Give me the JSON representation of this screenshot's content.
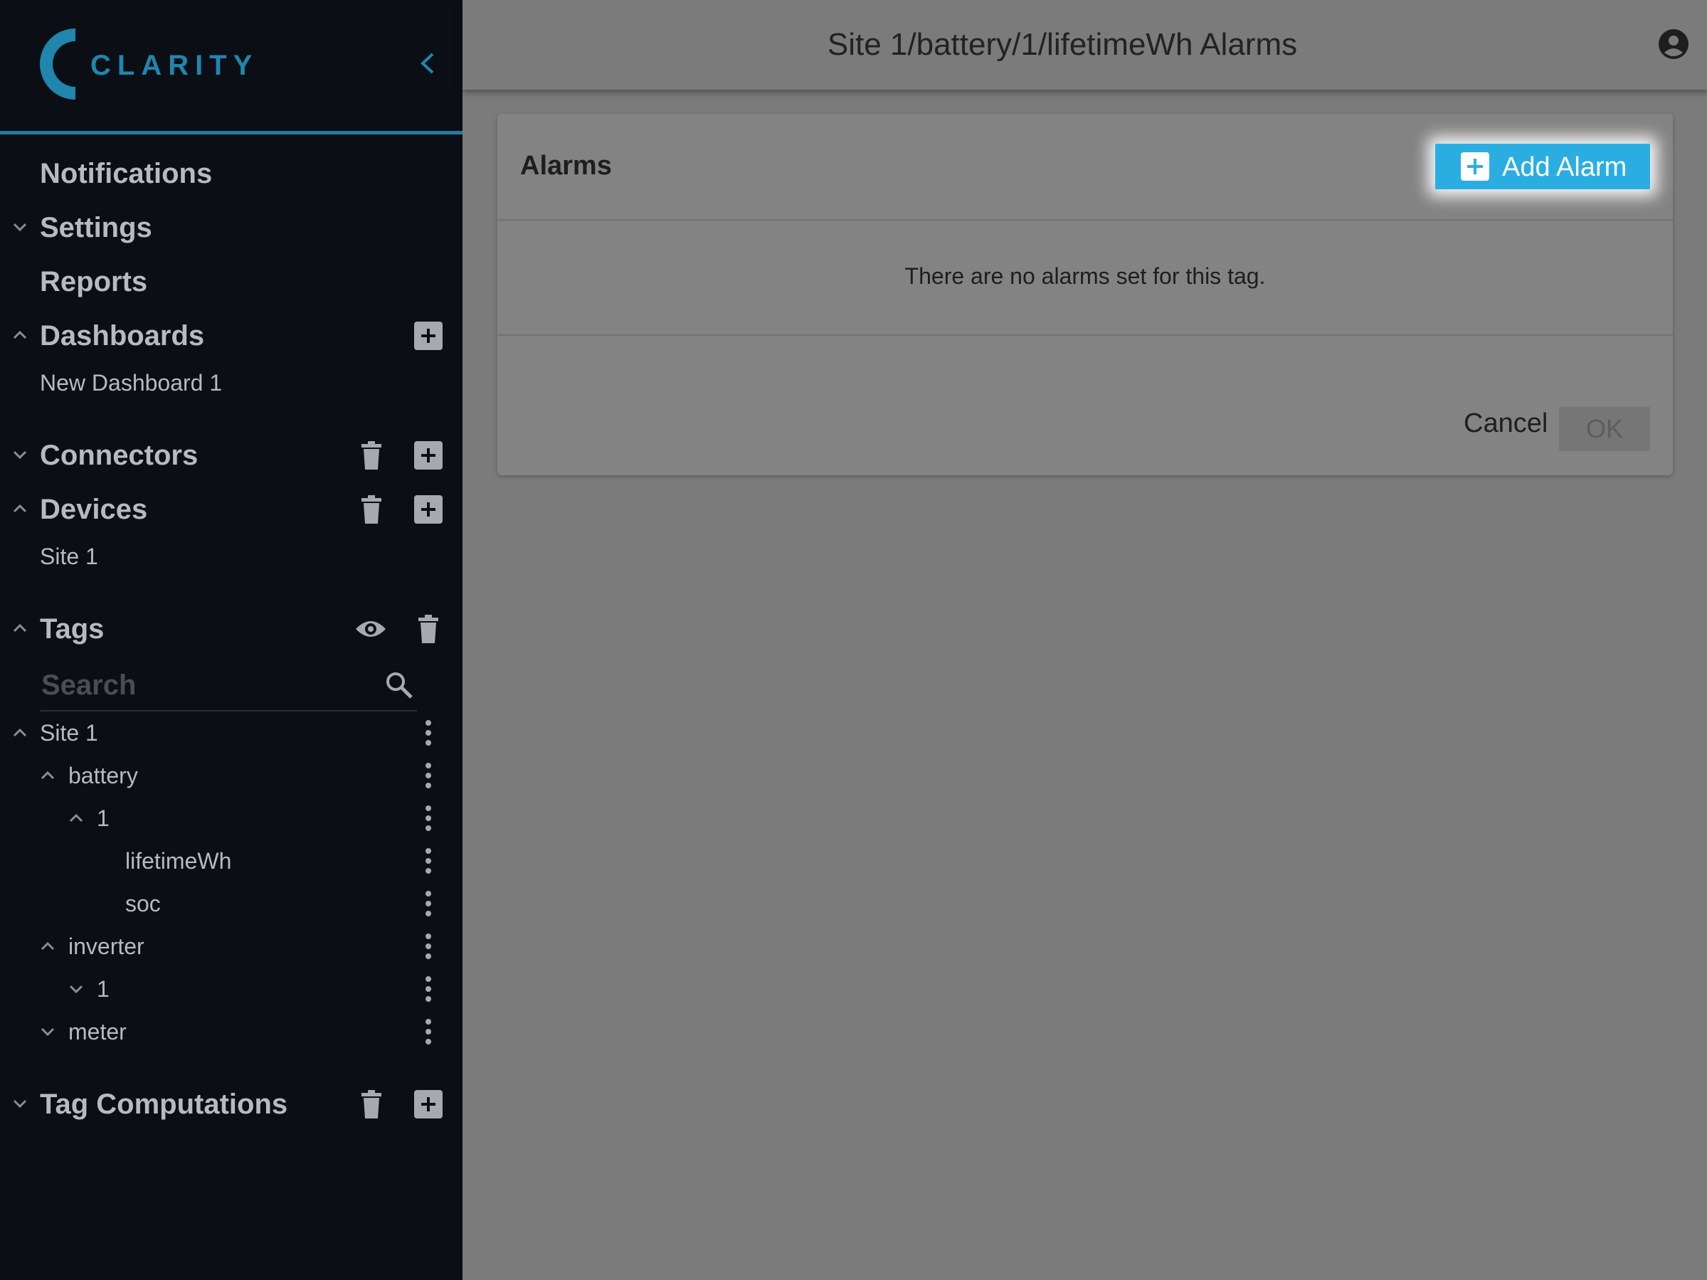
{
  "app": {
    "logo_text": "CLARITY"
  },
  "header": {
    "title": "Site 1/battery/1/lifetimeWh Alarms"
  },
  "sidebar": {
    "notifications": "Notifications",
    "settings": "Settings",
    "reports": "Reports",
    "dashboards": {
      "label": "Dashboards",
      "items": [
        "New Dashboard 1"
      ]
    },
    "connectors": {
      "label": "Connectors"
    },
    "devices": {
      "label": "Devices",
      "items": [
        "Site 1"
      ]
    },
    "tags": {
      "label": "Tags",
      "search_placeholder": "Search",
      "tree": {
        "site": "Site 1",
        "battery": "battery",
        "battery_1": "1",
        "lifetime": "lifetimeWh",
        "soc": "soc",
        "inverter": "inverter",
        "inverter_1": "1",
        "meter": "meter"
      }
    },
    "tag_computations": {
      "label": "Tag Computations"
    }
  },
  "card": {
    "title": "Alarms",
    "add_label": "Add Alarm",
    "empty_text": "There are no alarms set for this tag.",
    "cancel_label": "Cancel",
    "ok_label": "OK"
  },
  "colors": {
    "accent": "#2aaee2",
    "brand": "#1f86ad",
    "sidebar_bg": "#0b0e14"
  }
}
